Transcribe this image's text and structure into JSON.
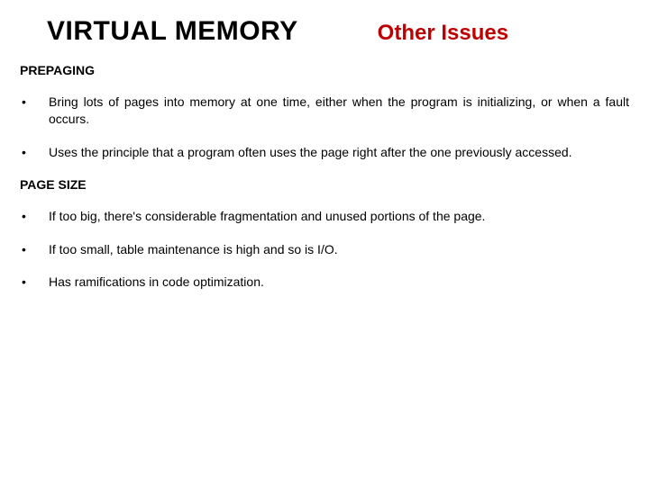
{
  "header": {
    "main_title": "VIRTUAL MEMORY",
    "sub_title": "Other Issues"
  },
  "sections": [
    {
      "heading": "PREPAGING",
      "bullets": [
        "Bring lots of pages into memory at one time, either when the program is initializing, or when a fault occurs.",
        "Uses the principle that a program often uses the page right after the one previously accessed."
      ]
    },
    {
      "heading": "PAGE SIZE",
      "bullets": [
        "If too big, there's considerable fragmentation and unused portions of the page.",
        "If too small, table maintenance is high and so is I/O.",
        " Has ramifications in code optimization."
      ]
    }
  ],
  "bullet_char": "•"
}
